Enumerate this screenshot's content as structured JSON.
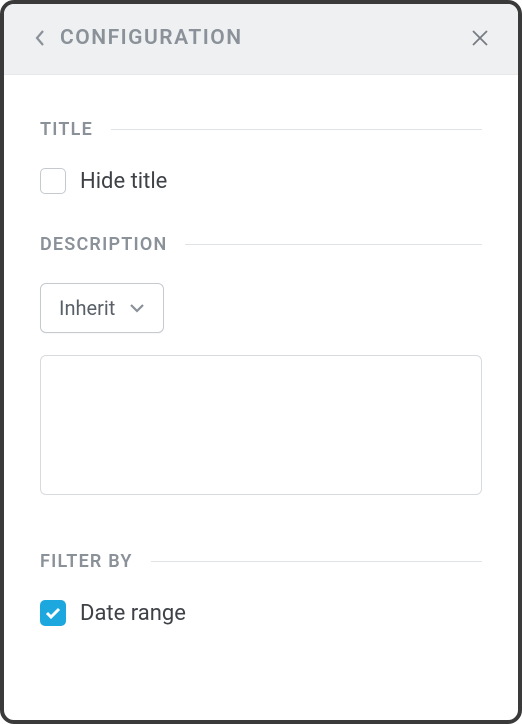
{
  "header": {
    "title": "CONFIGURATION"
  },
  "sections": {
    "title": {
      "label": "TITLE",
      "hide_title_label": "Hide title",
      "hide_title_checked": false
    },
    "description": {
      "label": "DESCRIPTION",
      "dropdown_value": "Inherit",
      "text_value": ""
    },
    "filter_by": {
      "label": "FILTER BY",
      "date_range_label": "Date range",
      "date_range_checked": true
    }
  }
}
